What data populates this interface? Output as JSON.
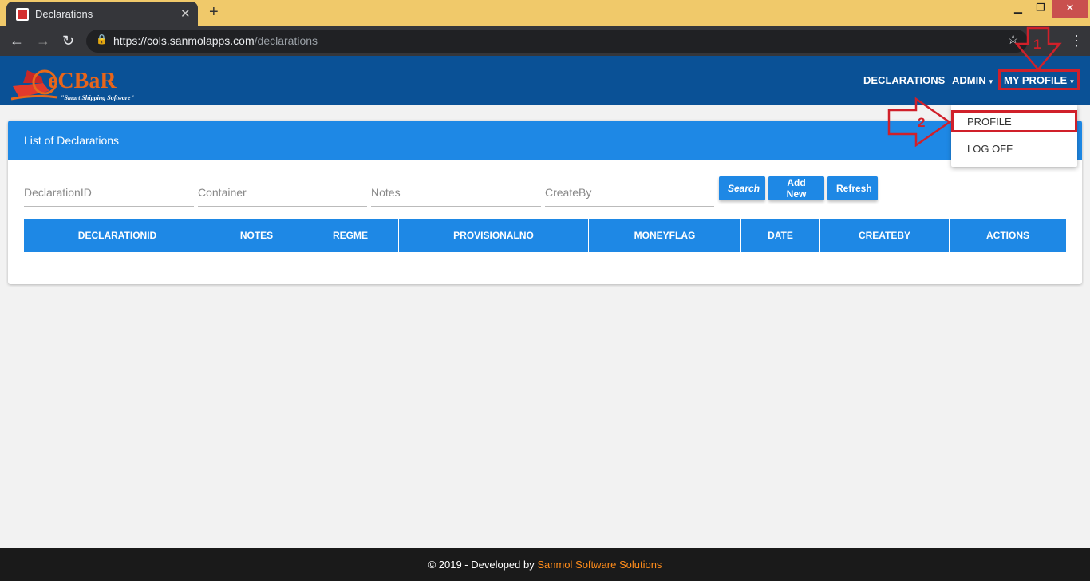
{
  "browser": {
    "tab_title": "Declarations",
    "url_host": "https://cols.sanmolapps.com",
    "url_path": "/declarations"
  },
  "header": {
    "logo_text": "eCBaR",
    "logo_tagline": "\"Smart Shipping Software\"",
    "nav": [
      "DECLARATIONS",
      "ADMIN",
      "MY PROFILE"
    ]
  },
  "dropdown": {
    "items": [
      "PROFILE",
      "LOG OFF"
    ]
  },
  "panel": {
    "title": "List of Declarations",
    "filters": {
      "declaration_id": "DeclarationID",
      "container": "Container",
      "notes": "Notes",
      "create_by": "CreateBy"
    },
    "buttons": {
      "search": "Search",
      "add_new": "Add New",
      "refresh": "Refresh"
    },
    "columns": [
      "DECLARATIONID",
      "NOTES",
      "REGME",
      "PROVISIONALNO",
      "MONEYFLAG",
      "DATE",
      "CREATEBY",
      "ACTIONS"
    ]
  },
  "annotations": {
    "step1": "1",
    "step2": "2",
    "color": "#d0202a"
  },
  "footer": {
    "text": "© 2019 - Developed by ",
    "link": "Sanmol Software Solutions"
  },
  "colors": {
    "navbar": "#0a5196",
    "primary": "#1e88e5",
    "accent": "#ff8c1a"
  }
}
